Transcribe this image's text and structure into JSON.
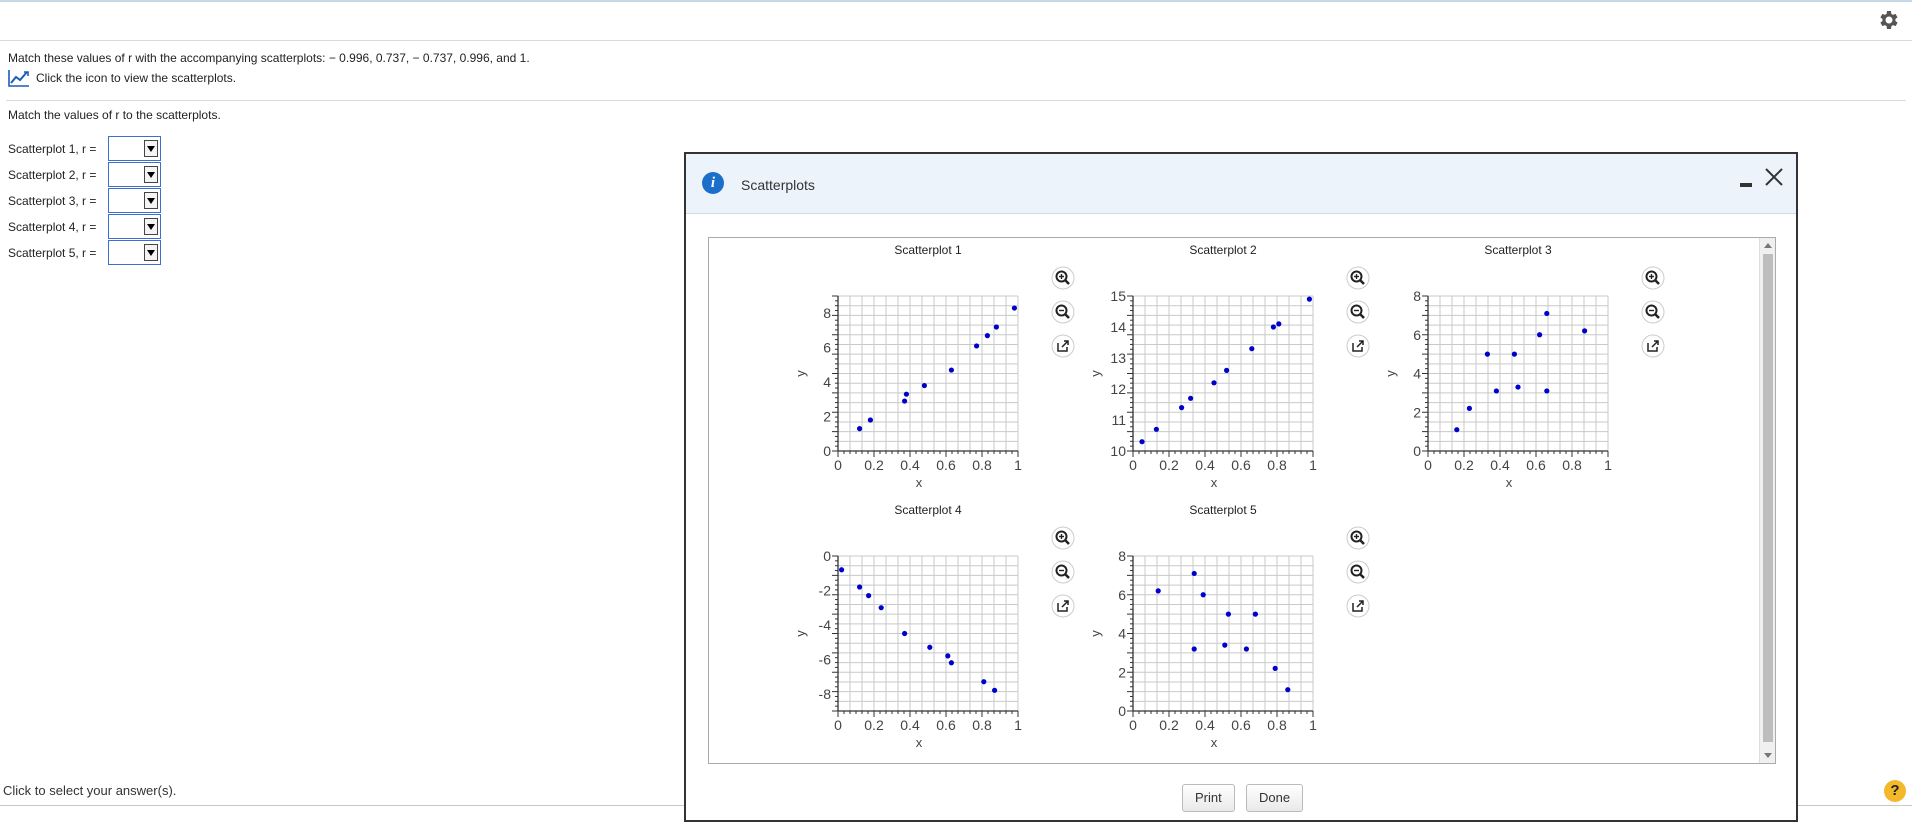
{
  "question": {
    "text": "Match these values of r with the accompanying scatterplots:  − 0.996, 0.737,  − 0.737, 0.996, and 1.",
    "icon_hint": "Click the icon to view the scatterplots.",
    "match_title": "Match the values of r to the scatterplots."
  },
  "answers": [
    {
      "label": "Scatterplot 1, r ="
    },
    {
      "label": "Scatterplot 2, r ="
    },
    {
      "label": "Scatterplot 3, r ="
    },
    {
      "label": "Scatterplot 4, r ="
    },
    {
      "label": "Scatterplot 5, r ="
    }
  ],
  "footer": {
    "text": "Click to select your answer(s).",
    "help": "?"
  },
  "icons": {
    "settings": "gear-icon",
    "chart": "line-chart-icon",
    "info": "info-icon",
    "zoom_in": "zoom-in-icon",
    "zoom_out": "zoom-out-icon",
    "popout": "external-link-icon",
    "help": "help-icon"
  },
  "colors": {
    "points": "#0000cc",
    "help_badge": "#f3b92b",
    "info_badge": "#1c6fc9"
  },
  "modal": {
    "title": "Scatterplots",
    "info_glyph": "i",
    "buttons": {
      "print": "Print",
      "done": "Done"
    }
  },
  "chart_data": [
    {
      "type": "scatter",
      "title": "Scatterplot 1",
      "xlabel": "x",
      "ylabel": "y",
      "xlim": [
        0,
        1
      ],
      "ylim": [
        0,
        9
      ],
      "xticks": [
        "0",
        "0.2",
        "0.4",
        "0.6",
        "0.8",
        "1"
      ],
      "yticks": [
        {
          "v": 0,
          "t": "0"
        },
        {
          "v": 2,
          "t": "2"
        },
        {
          "v": 4,
          "t": "4"
        },
        {
          "v": 6,
          "t": "6"
        },
        {
          "v": 8,
          "t": "8"
        }
      ],
      "points": [
        [
          0.12,
          1.3
        ],
        [
          0.18,
          1.8
        ],
        [
          0.37,
          2.9
        ],
        [
          0.38,
          3.3
        ],
        [
          0.48,
          3.8
        ],
        [
          0.63,
          4.7
        ],
        [
          0.77,
          6.1
        ],
        [
          0.83,
          6.7
        ],
        [
          0.88,
          7.2
        ],
        [
          0.98,
          8.3
        ]
      ]
    },
    {
      "type": "scatter",
      "title": "Scatterplot 2",
      "xlabel": "x",
      "ylabel": "y",
      "xlim": [
        0,
        1
      ],
      "ylim": [
        10,
        15
      ],
      "xticks": [
        "0",
        "0.2",
        "0.4",
        "0.6",
        "0.8",
        "1"
      ],
      "yticks": [
        {
          "v": 10,
          "t": "10"
        },
        {
          "v": 11,
          "t": "11"
        },
        {
          "v": 12,
          "t": "12"
        },
        {
          "v": 13,
          "t": "13"
        },
        {
          "v": 14,
          "t": "14"
        },
        {
          "v": 15,
          "t": "15"
        }
      ],
      "points": [
        [
          0.05,
          10.3
        ],
        [
          0.13,
          10.7
        ],
        [
          0.27,
          11.4
        ],
        [
          0.32,
          11.7
        ],
        [
          0.45,
          12.2
        ],
        [
          0.52,
          12.6
        ],
        [
          0.66,
          13.3
        ],
        [
          0.78,
          14.0
        ],
        [
          0.81,
          14.1
        ],
        [
          0.98,
          14.9
        ]
      ]
    },
    {
      "type": "scatter",
      "title": "Scatterplot 3",
      "xlabel": "x",
      "ylabel": "y",
      "xlim": [
        0,
        1
      ],
      "ylim": [
        0,
        8
      ],
      "xticks": [
        "0",
        "0.2",
        "0.4",
        "0.6",
        "0.8",
        "1"
      ],
      "yticks": [
        {
          "v": 0,
          "t": "0"
        },
        {
          "v": 2,
          "t": "2"
        },
        {
          "v": 4,
          "t": "4"
        },
        {
          "v": 6,
          "t": "6"
        },
        {
          "v": 8,
          "t": "8"
        }
      ],
      "points": [
        [
          0.16,
          1.1
        ],
        [
          0.23,
          2.2
        ],
        [
          0.33,
          5.0
        ],
        [
          0.38,
          3.1
        ],
        [
          0.48,
          5.0
        ],
        [
          0.5,
          3.3
        ],
        [
          0.62,
          6.0
        ],
        [
          0.66,
          7.1
        ],
        [
          0.66,
          3.1
        ],
        [
          0.87,
          6.2
        ]
      ]
    },
    {
      "type": "scatter",
      "title": "Scatterplot 4",
      "xlabel": "x",
      "ylabel": "y",
      "xlim": [
        0,
        1
      ],
      "ylim": [
        -9,
        0
      ],
      "xticks": [
        "0",
        "0.2",
        "0.4",
        "0.6",
        "0.8",
        "1"
      ],
      "yticks": [
        {
          "v": 0,
          "t": "0"
        },
        {
          "v": -2,
          "t": "-2"
        },
        {
          "v": -4,
          "t": "-4"
        },
        {
          "v": -6,
          "t": "-6"
        },
        {
          "v": -8,
          "t": "-8"
        }
      ],
      "points": [
        [
          0.02,
          -0.8
        ],
        [
          0.12,
          -1.8
        ],
        [
          0.17,
          -2.3
        ],
        [
          0.24,
          -3.0
        ],
        [
          0.37,
          -4.5
        ],
        [
          0.51,
          -5.3
        ],
        [
          0.61,
          -5.8
        ],
        [
          0.63,
          -6.2
        ],
        [
          0.81,
          -7.3
        ],
        [
          0.87,
          -7.8
        ]
      ]
    },
    {
      "type": "scatter",
      "title": "Scatterplot 5",
      "xlabel": "x",
      "ylabel": "y",
      "xlim": [
        0,
        1
      ],
      "ylim": [
        0,
        8
      ],
      "xticks": [
        "0",
        "0.2",
        "0.4",
        "0.6",
        "0.8",
        "1"
      ],
      "yticks": [
        {
          "v": 0,
          "t": "0"
        },
        {
          "v": 2,
          "t": "2"
        },
        {
          "v": 4,
          "t": "4"
        },
        {
          "v": 6,
          "t": "6"
        },
        {
          "v": 8,
          "t": "8"
        }
      ],
      "points": [
        [
          0.14,
          6.2
        ],
        [
          0.34,
          7.1
        ],
        [
          0.34,
          3.2
        ],
        [
          0.39,
          6.0
        ],
        [
          0.51,
          3.4
        ],
        [
          0.53,
          5.0
        ],
        [
          0.63,
          3.2
        ],
        [
          0.68,
          5.0
        ],
        [
          0.79,
          2.2
        ],
        [
          0.86,
          1.1
        ]
      ]
    }
  ]
}
